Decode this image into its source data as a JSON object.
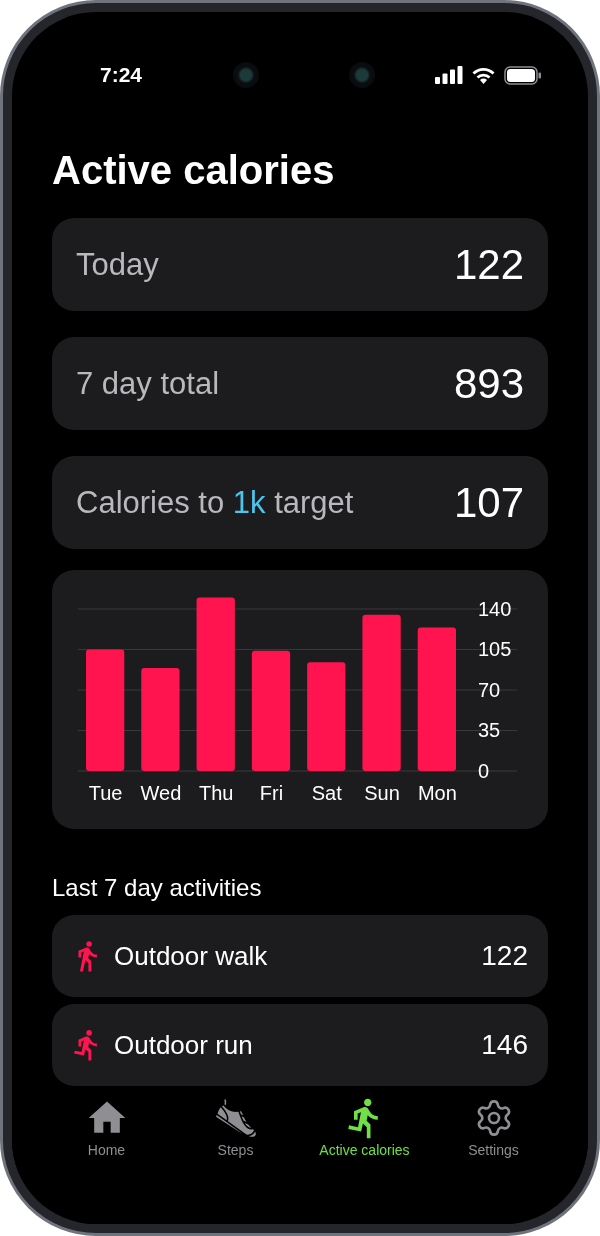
{
  "status_bar": {
    "time": "7:24"
  },
  "title": "Active calories",
  "stats": [
    {
      "parts": [
        {
          "text": "Today",
          "highlight": false
        }
      ],
      "value": "122"
    },
    {
      "parts": [
        {
          "text": "7 day total",
          "highlight": false
        }
      ],
      "value": "893"
    },
    {
      "parts": [
        {
          "text": "Calories to ",
          "highlight": false
        },
        {
          "text": "1k",
          "highlight": true
        },
        {
          "text": " target",
          "highlight": false
        }
      ],
      "value": "107"
    }
  ],
  "chart": {
    "chart_data": {
      "type": "bar",
      "categories": [
        "Tue",
        "Wed",
        "Thu",
        "Fri",
        "Sat",
        "Sun",
        "Mon"
      ],
      "values": [
        105,
        89,
        150,
        104,
        94,
        135,
        124
      ],
      "ylim": [
        0,
        150
      ],
      "yticks": [
        0,
        35,
        70,
        105,
        140
      ],
      "grid": true
    }
  },
  "section_title": "Last 7 day activities",
  "activities": [
    {
      "kind": "walk",
      "name": "Outdoor walk",
      "value": "122"
    },
    {
      "kind": "run",
      "name": "Outdoor run",
      "value": "146"
    }
  ],
  "tabs": [
    {
      "kind": "home",
      "label": "Home",
      "selected": false
    },
    {
      "kind": "steps",
      "label": "Steps",
      "selected": false
    },
    {
      "kind": "calories",
      "label": "Active calories",
      "selected": true
    },
    {
      "kind": "settings",
      "label": "Settings",
      "selected": false
    }
  ]
}
